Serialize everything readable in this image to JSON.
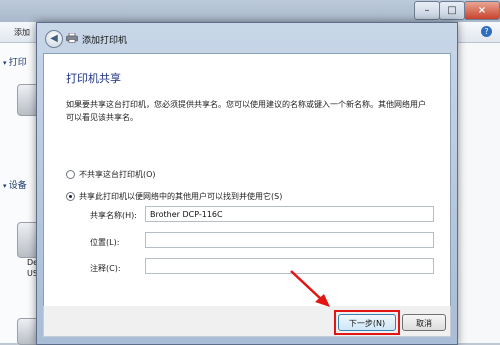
{
  "background": {
    "toolbar_label": "添加",
    "help_icon": "question-icon",
    "left_items": [
      {
        "label": "打印"
      },
      {
        "label": "设备"
      }
    ],
    "device_label_1": "De",
    "device_label_2": "US"
  },
  "dialog": {
    "title": "添加打印机",
    "heading": "打印机共享",
    "description": "如果要共享这台打印机，您必须提供共享名。您可以使用建议的名称或键入一个新名称。其他网络用户可以看见该共享名。",
    "options": [
      {
        "label": "不共享这台打印机(O)",
        "selected": false
      },
      {
        "label": "共享此打印机以便网络中的其他用户可以找到并使用它(S)",
        "selected": true
      }
    ],
    "fields": {
      "share_name_label": "共享名称(H):",
      "share_name_value": "Brother DCP-116C",
      "location_label": "位置(L):",
      "location_value": "",
      "comment_label": "注释(C):",
      "comment_value": ""
    },
    "next_label": "下一步(N)",
    "cancel_label": "取消"
  },
  "colors": {
    "heading": "#1e3287",
    "annotation_red": "#e21414"
  }
}
